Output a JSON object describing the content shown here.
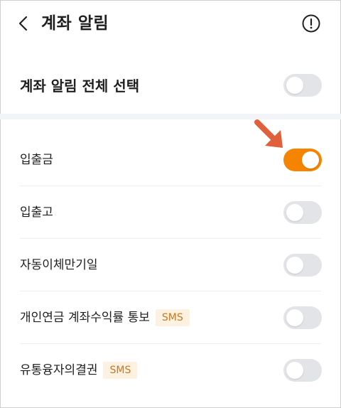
{
  "header": {
    "title": "계좌 알림",
    "back_icon": "chevron-left-icon",
    "info_icon": "info-circle-icon"
  },
  "master": {
    "label": "계좌 알림 전체 선택",
    "enabled": false
  },
  "settings": [
    {
      "label": "입출금",
      "enabled": true,
      "badge": ""
    },
    {
      "label": "입출고",
      "enabled": false,
      "badge": ""
    },
    {
      "label": "자동이체만기일",
      "enabled": false,
      "badge": ""
    },
    {
      "label": "개인연금 계좌수익률 통보",
      "enabled": false,
      "badge": "SMS"
    },
    {
      "label": "유통융자의결권",
      "enabled": false,
      "badge": "SMS"
    }
  ],
  "colors": {
    "toggle_on": "#f58400",
    "toggle_off": "#e2e4e8",
    "badge_bg": "#fdf1e2",
    "badge_text": "#c9781d",
    "annotation_arrow": "#e0603c"
  }
}
